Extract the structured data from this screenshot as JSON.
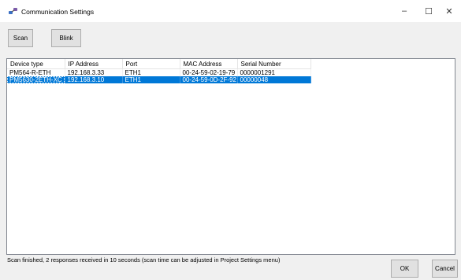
{
  "window": {
    "title": "Communication Settings",
    "controls": {
      "minimize": "–",
      "maximize": "☐",
      "close": "✕"
    }
  },
  "toolbar": {
    "scan_label": "Scan",
    "blink_label": "Blink"
  },
  "table": {
    "columns": [
      "Device type",
      "IP Address",
      "Port",
      "MAC Address",
      "Serial Number"
    ],
    "rows": [
      {
        "device_type": "PM564-R-ETH",
        "ip_address": "192.168.3.33",
        "port": "ETH1",
        "mac_address": "00-24-59-02-19-79",
        "serial_number": "0000001291",
        "selected": false
      },
      {
        "device_type": "PM5630-2ETH-XC",
        "ip_address": "192.168.3.10",
        "port": "ETH1",
        "mac_address": "00-24-59-0D-2F-92",
        "serial_number": "00000048",
        "selected": true
      }
    ]
  },
  "status": {
    "text": "Scan finished, 2 responses received in 10 seconds (scan time can be adjusted in Project Settings menu)"
  },
  "footer": {
    "ok_label": "OK",
    "cancel_label": "Cancel"
  },
  "colors": {
    "selection": "#0078d7",
    "title_bar": "#ffffff",
    "window_bg": "#f0f0f0"
  },
  "icons": {
    "app": "network-plug-icon"
  }
}
